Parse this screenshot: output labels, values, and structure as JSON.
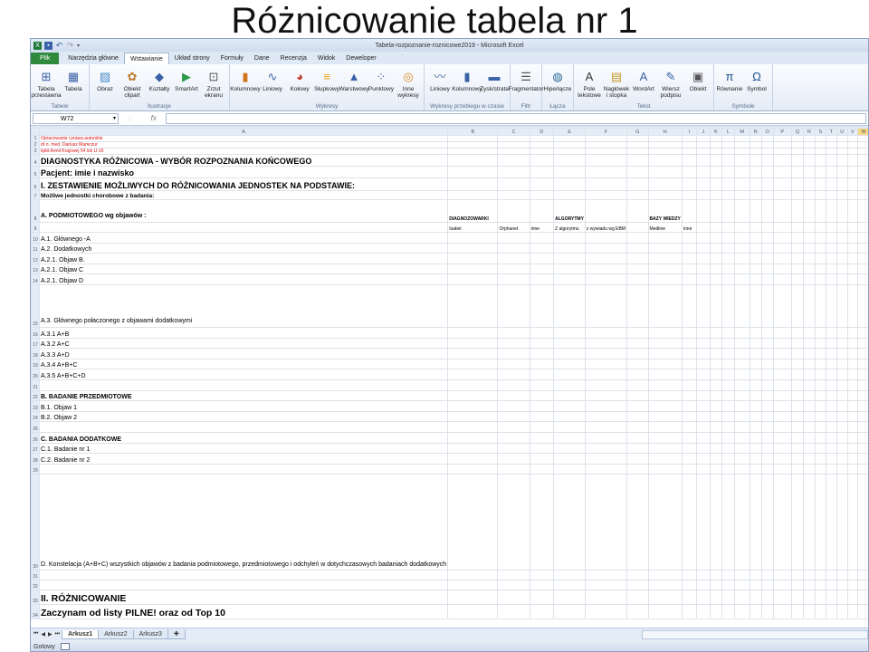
{
  "slide_title": "Różnicowanie tabela nr 1",
  "window_title": "Tabela-rozpoznanie-roznicowe2019  -  Microsoft Excel",
  "ribbon_tabs": [
    "Plik",
    "Narzędzia główne",
    "Wstawianie",
    "Układ strony",
    "Formuły",
    "Dane",
    "Recenzja",
    "Widok",
    "Deweloper"
  ],
  "ribbon_groups": [
    {
      "name": "Tabele",
      "buttons": [
        {
          "label": "Tabela przestawna",
          "icon": "pivot-table-icon"
        },
        {
          "label": "Tabela",
          "icon": "table-icon"
        }
      ]
    },
    {
      "name": "Ilustracje",
      "buttons": [
        {
          "label": "Obraz",
          "icon": "picture-icon"
        },
        {
          "label": "Obiekt clipart",
          "icon": "clipart-icon"
        },
        {
          "label": "Kształty",
          "icon": "shapes-icon"
        },
        {
          "label": "SmartArt",
          "icon": "smartart-icon"
        },
        {
          "label": "Zrzut ekranu",
          "icon": "screenshot-icon"
        }
      ]
    },
    {
      "name": "Wykresy",
      "buttons": [
        {
          "label": "Kolumnowy",
          "icon": "column-chart-icon"
        },
        {
          "label": "Liniowy",
          "icon": "line-chart-icon"
        },
        {
          "label": "Kołowy",
          "icon": "pie-chart-icon"
        },
        {
          "label": "Słupkowy",
          "icon": "bar-chart-icon"
        },
        {
          "label": "Warstwowy",
          "icon": "area-chart-icon"
        },
        {
          "label": "Punktowy",
          "icon": "scatter-chart-icon"
        },
        {
          "label": "Inne wykresy",
          "icon": "other-charts-icon"
        }
      ]
    },
    {
      "name": "Wykresy przebiegu w czasie",
      "buttons": [
        {
          "label": "Liniowy",
          "icon": "sparkline-line-icon"
        },
        {
          "label": "Kolumnowy",
          "icon": "sparkline-column-icon"
        },
        {
          "label": "Zysk/strata",
          "icon": "sparkline-winloss-icon"
        }
      ]
    },
    {
      "name": "Filtr",
      "buttons": [
        {
          "label": "Fragmentator",
          "icon": "slicer-icon"
        }
      ]
    },
    {
      "name": "Łącza",
      "buttons": [
        {
          "label": "Hiperłącze",
          "icon": "hyperlink-icon"
        }
      ]
    },
    {
      "name": "Tekst",
      "buttons": [
        {
          "label": "Pole tekstowe",
          "icon": "textbox-icon"
        },
        {
          "label": "Nagłówek i stopka",
          "icon": "header-footer-icon"
        },
        {
          "label": "WordArt",
          "icon": "wordart-icon"
        },
        {
          "label": "Wiersz podpisu",
          "icon": "signature-line-icon"
        },
        {
          "label": "Obiekt",
          "icon": "object-icon"
        }
      ]
    },
    {
      "name": "Symbole",
      "buttons": [
        {
          "label": "Równanie",
          "icon": "equation-icon"
        },
        {
          "label": "Symbol",
          "icon": "symbol-icon"
        }
      ]
    }
  ],
  "name_box": "W72",
  "fx_label": "fx",
  "columns": [
    "A",
    "B",
    "C",
    "D",
    "E",
    "F",
    "G",
    "H",
    "I",
    "J",
    "K",
    "L",
    "M",
    "N",
    "O",
    "P",
    "Q",
    "R",
    "S",
    "T",
    "U",
    "V",
    "W"
  ],
  "rows": [
    {
      "n": "1",
      "a": "Opracowanie i prawa autorskie",
      "style": "red"
    },
    {
      "n": "2",
      "a": "dr n. med. Dariusz Mamczur",
      "style": "red"
    },
    {
      "n": "3",
      "a": "kpbt Armii Krajowej 54 lok U-10",
      "style": "red"
    },
    {
      "n": "4",
      "a": "DIAGNOSTYKA RÓŻNICOWA - WYBÓR ROZPOZNANIA KOŃCOWEGO",
      "style": "b8"
    },
    {
      "n": "5",
      "a": "Pacjent: imie i nazwisko",
      "style": "b8"
    },
    {
      "n": "6",
      "a": "I. ZESTAWIENIE MOŻLIWYCH DO RÓŻNICOWANIA JEDNOSTEK NA PODSTAWIE:",
      "style": "b8"
    },
    {
      "n": "7",
      "a": "Możliwe jednostki chorobowe z badania:",
      "style": "b7s"
    },
    {
      "n": "8",
      "a": "A. PODMIOTOWEGO wg objawów :",
      "b": "DIAGNOZOWARKI",
      "e": "ALGORYTMY",
      "h": "BAZY WIEDZY",
      "style": "r8"
    },
    {
      "n": "9",
      "b": "Isabel",
      "c": "Orphanet",
      "d": "inne",
      "e": "Z algorytmu",
      "f": "z wywiadu wg EBM",
      "h": "Medline",
      "i": "inne",
      "style": "tinyrow"
    },
    {
      "n": "10",
      "a": "A.1. Głównego -A",
      "style": "s7b"
    },
    {
      "n": "11",
      "a": "A.2. Dodatkowych",
      "style": "s7"
    },
    {
      "n": "12",
      "a": "A.2.1. Objaw B.",
      "style": "s7"
    },
    {
      "n": "13",
      "a": "A.2.1. Objaw C",
      "style": "s7"
    },
    {
      "n": "14",
      "a": "A.2.1. Objaw D",
      "style": "s7"
    },
    {
      "n": "15",
      "a": "A.3. Głównego połaczonego z objawami dodatkowymi",
      "style": "wrapbold"
    },
    {
      "n": "16",
      "a": "A.3.1 A+B",
      "style": "s7"
    },
    {
      "n": "17",
      "a": "A.3.2 A+C",
      "style": "s7"
    },
    {
      "n": "18",
      "a": "A.3.3 A+D",
      "style": "s7"
    },
    {
      "n": "19",
      "a": "A.3.4 A+B+C",
      "style": "s7"
    },
    {
      "n": "20",
      "a": "A.3.5 A+B+C+D",
      "style": "s7"
    },
    {
      "n": "21",
      "a": "",
      "style": "s7"
    },
    {
      "n": "22",
      "a": "B. BADANIE PRZEDMIOTOWE",
      "style": "b7"
    },
    {
      "n": "23",
      "a": "B.1. Objaw 1",
      "style": "s7"
    },
    {
      "n": "24",
      "a": "B.2. Objaw 2",
      "style": "s7"
    },
    {
      "n": "25",
      "a": "",
      "style": "s7"
    },
    {
      "n": "26",
      "a": "C. BADANIA DODATKOWE",
      "style": "b7"
    },
    {
      "n": "27",
      "a": "C.1. Badanie nr 1",
      "style": "s7"
    },
    {
      "n": "28",
      "a": "C.2. Badanie nr 2",
      "style": "s7"
    },
    {
      "n": "29",
      "a": "",
      "style": "s7"
    },
    {
      "n": "30",
      "a": "D. Konstelacja (A+B+C) wszystkich objawów z badania podmiotowego, przedmiotowego i odchyleń w dotychczasowych badaniach dodatkowych",
      "style": "wrapD"
    },
    {
      "n": "31",
      "a": "",
      "style": "s7"
    },
    {
      "n": "32",
      "a": "",
      "style": "s7"
    },
    {
      "n": "33",
      "a": "II. RÓŻNICOWANIE",
      "style": "b10"
    },
    {
      "n": "34",
      "a": "Zaczynam od listy PILNE! oraz od Top 10",
      "style": "b10"
    }
  ],
  "sheet_tabs": [
    "Arkusz1",
    "Arkusz2",
    "Arkusz3"
  ],
  "status": "Gotowy"
}
